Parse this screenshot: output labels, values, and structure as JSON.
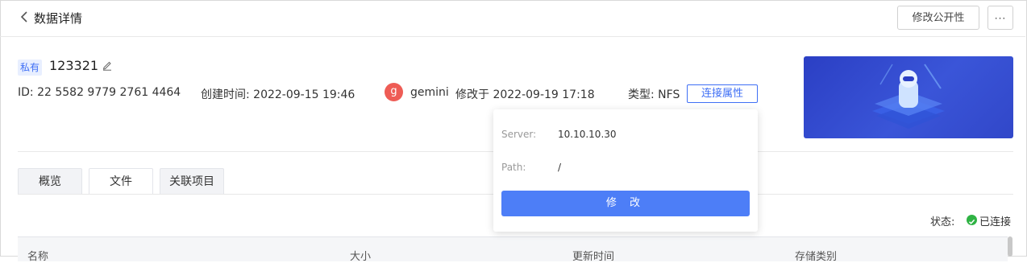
{
  "header": {
    "title": "数据详情",
    "public_button": "修改公开性",
    "more_button": "···"
  },
  "dataset": {
    "visibility_badge": "私有",
    "name": "123321",
    "id_text": "ID: 22 5582 9779 2761 4464",
    "created_text": "创建时间: 2022-09-15 19:46",
    "owner_initial": "g",
    "owner_name": "gemini",
    "modified_text": "修改于 2022-09-19 17:18",
    "type_text": "类型: NFS",
    "connection_button": "连接属性"
  },
  "tabs": [
    {
      "label": "概览",
      "active": false
    },
    {
      "label": "文件",
      "active": true
    },
    {
      "label": "关联项目",
      "active": false
    }
  ],
  "status": {
    "label": "状态:",
    "value": "已连接",
    "color": "#2fb344"
  },
  "table": {
    "columns": [
      "名称",
      "大小",
      "更新时间",
      "存储类别"
    ]
  },
  "popover": {
    "server_label": "Server:",
    "server_value": "10.10.10.30",
    "path_label": "Path:",
    "path_value": "/",
    "edit_button": "修 改"
  },
  "colors": {
    "accent": "#3f6ff5",
    "primary_button": "#4d7ef7",
    "avatar": "#ee5c55"
  }
}
